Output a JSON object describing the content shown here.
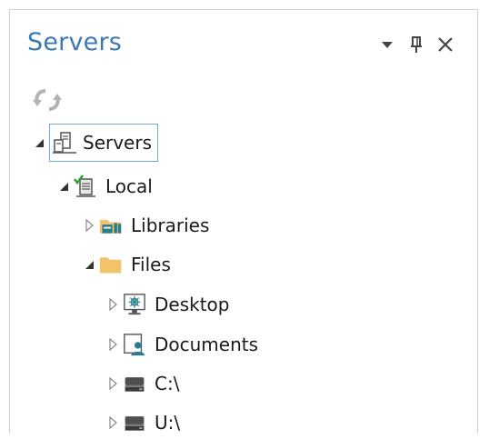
{
  "panel": {
    "title": "Servers",
    "icons": {
      "dropdown": "dropdown-triangle-icon",
      "pin": "pin-icon",
      "close": "close-icon",
      "refresh": "refresh-icon"
    }
  },
  "tree": {
    "root": {
      "label": "Servers",
      "expanded": true,
      "icon": "server-icon"
    },
    "local": {
      "label": "Local",
      "expanded": true,
      "icon": "local-server-icon"
    },
    "libraries": {
      "label": "Libraries",
      "expanded": false,
      "icon": "libraries-folder-icon"
    },
    "files": {
      "label": "Files",
      "expanded": true,
      "icon": "folder-icon"
    },
    "desktop": {
      "label": "Desktop",
      "expanded": false,
      "icon": "desktop-icon"
    },
    "documents": {
      "label": "Documents",
      "expanded": false,
      "icon": "documents-icon"
    },
    "c_drive": {
      "label": "C:\\",
      "expanded": false,
      "icon": "drive-icon"
    },
    "u_drive": {
      "label": "U:\\",
      "expanded": false,
      "icon": "drive-icon"
    }
  },
  "colors": {
    "title": "#3c78b4",
    "selection_border": "#74a9d8",
    "folder": "#f2c36b",
    "teal": "#2a7d8c"
  }
}
